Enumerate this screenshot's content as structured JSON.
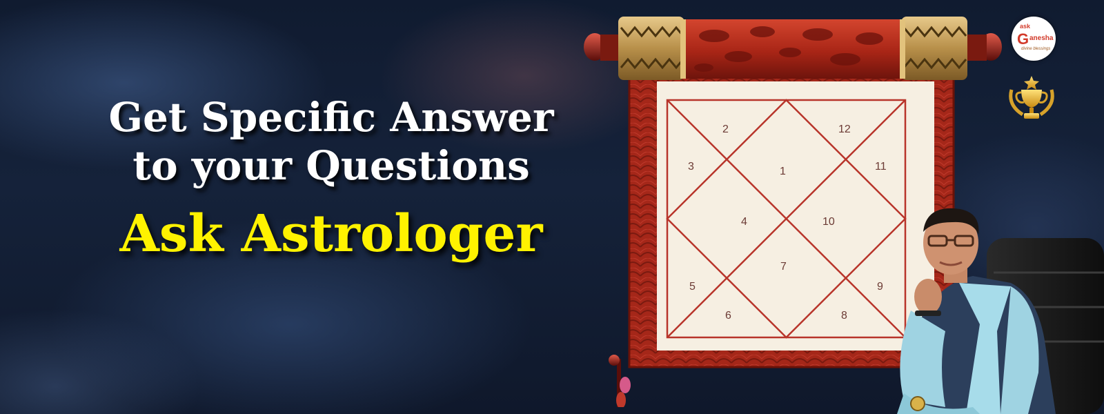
{
  "headline": {
    "line1": "Get Specific Answer",
    "line2": "to your Questions",
    "line3": "Ask Astrologer"
  },
  "chart": {
    "houses": [
      "1",
      "2",
      "3",
      "4",
      "5",
      "6",
      "7",
      "8",
      "9",
      "10",
      "11",
      "12"
    ]
  },
  "logo": {
    "ask": "ask",
    "g": "G",
    "anesha": "anesha",
    "tagline": "divine blessings"
  },
  "colors": {
    "headline_white": "#ffffff",
    "headline_yellow": "#fff200",
    "scroll_red": "#b3281c",
    "scroll_gold": "#c9a45a",
    "paper": "#f6efe2",
    "chart_lines": "#b8342a"
  },
  "icons": [
    "logo-badge",
    "trophy-icon",
    "scroll-illustration",
    "astrologer-photo"
  ]
}
